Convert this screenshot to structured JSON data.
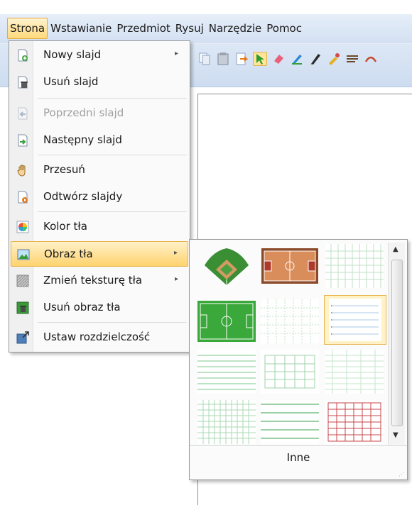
{
  "menubar": {
    "items": [
      "Strona",
      "Wstawianie",
      "Przedmiot",
      "Rysuj",
      "Narzędzie",
      "Pomoc"
    ],
    "active": "Strona"
  },
  "menu": {
    "items": [
      {
        "label": "Nowy slajd",
        "icon": "new-slide-icon",
        "submenu": true,
        "disabled": false
      },
      {
        "label": "Usuń slajd",
        "icon": "delete-slide-icon",
        "submenu": false,
        "disabled": false
      },
      {
        "label": "Poprzedni slajd",
        "icon": "previous-slide-icon",
        "submenu": false,
        "disabled": true
      },
      {
        "label": "Następny slajd",
        "icon": "next-slide-icon",
        "submenu": false,
        "disabled": false
      },
      {
        "label": "Przesuń",
        "icon": "hand-icon",
        "submenu": false,
        "disabled": false
      },
      {
        "label": "Odtwórz slajdy",
        "icon": "play-slides-icon",
        "submenu": false,
        "disabled": false
      },
      {
        "label": "Kolor tła",
        "icon": "color-wheel-icon",
        "submenu": false,
        "disabled": false
      },
      {
        "label": "Obraz tła",
        "icon": "picture-icon",
        "submenu": true,
        "disabled": false,
        "highlighted": true
      },
      {
        "label": "Zmień teksturę tła",
        "icon": "texture-icon",
        "submenu": true,
        "disabled": false
      },
      {
        "label": "Usuń obraz tła",
        "icon": "remove-picture-icon",
        "submenu": false,
        "disabled": false
      },
      {
        "label": "Ustaw rozdzielczość",
        "icon": "resolution-icon",
        "submenu": false,
        "disabled": false
      }
    ]
  },
  "gallery": {
    "thumbnails": [
      "baseball-field",
      "basketball-court",
      "green-grid",
      "soccer-field",
      "dotted-grid",
      "lined-paper",
      "green-lines",
      "dashed-grid",
      "fine-grid",
      "dense-grid",
      "wide-lines",
      "red-brick-grid"
    ],
    "selected": "lined-paper",
    "more_label": "Inne"
  }
}
